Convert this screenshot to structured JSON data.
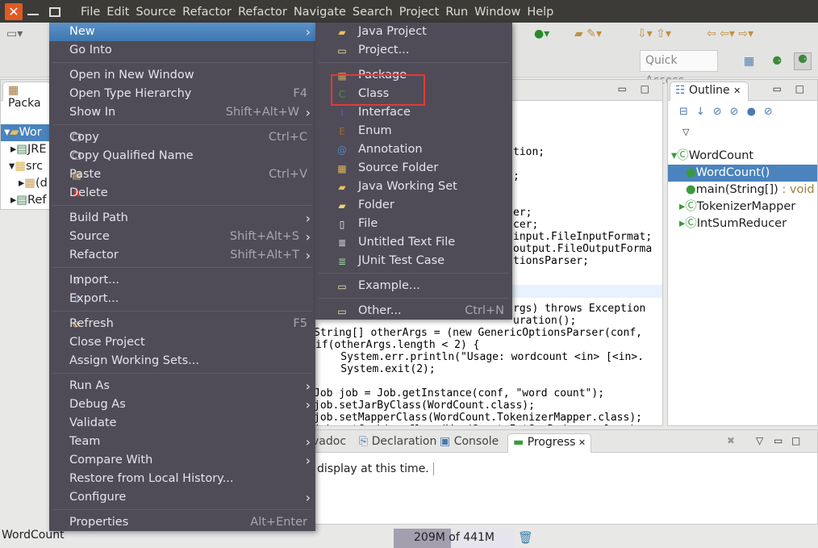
{
  "window": {
    "menus": [
      "File",
      "Edit",
      "Source",
      "Refactor",
      "Refactor",
      "Navigate",
      "Search",
      "Project",
      "Run",
      "Window",
      "Help"
    ]
  },
  "toolbar": {
    "quick_access": "Quick Access"
  },
  "package_explorer": {
    "tab": "Packa",
    "items": [
      "Wor",
      "JRE",
      "src",
      "(d",
      "Ref"
    ]
  },
  "editor": {
    "lines": [
      {
        "t": "tion;"
      },
      {
        "t": ";"
      },
      {
        "t": "er;"
      },
      {
        "t": "cer;"
      },
      {
        "t": "input.FileInputFormat;"
      },
      {
        "t": "output.FileOutputForma"
      },
      {
        "t": "tionsParser;"
      },
      {
        "t": "rgs) throws Exception"
      },
      {
        "t": "uration();"
      },
      {
        "t": "String[] otherArgs = (new GenericOptionsParser(conf,"
      },
      {
        "t": "if(otherArgs.length < 2) {"
      },
      {
        "t": "    System.err.println(\"Usage: wordcount <in> [<in>."
      },
      {
        "t": "    System.exit(2);"
      },
      {
        "t": "Job job = Job.getInstance(conf, \"word count\");"
      },
      {
        "t": "job.setJarByClass(WordCount.class);"
      },
      {
        "t": "job.setMapperClass(WordCount.TokenizerMapper.class);"
      },
      {
        "t": "job.setCombinerClass(WordCount.IntSumReducer.class);"
      }
    ]
  },
  "outline": {
    "tab": "Outline",
    "items": [
      {
        "label": "WordCount",
        "icon": "class-icon"
      },
      {
        "label": "WordCount()",
        "icon": "constructor-icon"
      },
      {
        "label": "main(String[])",
        "suffix": " : void",
        "icon": "method-icon"
      },
      {
        "label": "TokenizerMapper",
        "icon": "class-icon"
      },
      {
        "label": "IntSumReducer",
        "icon": "class-icon"
      }
    ]
  },
  "bottom": {
    "tabs": [
      "vadoc",
      "Declaration",
      "Console",
      "Progress"
    ],
    "message": "display at this time."
  },
  "status": {
    "selection": "WordCount",
    "memory": "209M of 441M",
    "heap_used_fraction": 0.47
  },
  "context_menu": [
    {
      "label": "New",
      "arrow": true,
      "highlight": true
    },
    {
      "label": "Go Into"
    },
    {
      "sep": true
    },
    {
      "label": "Open in New Window"
    },
    {
      "label": "Open Type Hierarchy",
      "shortcut": "F4"
    },
    {
      "label": "Show In",
      "shortcut": "Shift+Alt+W",
      "arrow": true
    },
    {
      "sep": true
    },
    {
      "label": "Copy",
      "shortcut": "Ctrl+C",
      "icon": "copy-icon",
      "glyph": "❐",
      "color": "#cfd6e6"
    },
    {
      "label": "Copy Qualified Name",
      "icon": "copy-icon",
      "glyph": "❐",
      "color": "#cfd6e6"
    },
    {
      "label": "Paste",
      "shortcut": "Ctrl+V",
      "icon": "paste-icon",
      "glyph": "▤",
      "color": "#e0c080"
    },
    {
      "label": "Delete",
      "icon": "delete-icon",
      "glyph": "✖",
      "color": "#e03030"
    },
    {
      "sep": true
    },
    {
      "label": "Build Path",
      "arrow": true
    },
    {
      "label": "Source",
      "shortcut": "Shift+Alt+S",
      "arrow": true
    },
    {
      "label": "Refactor",
      "shortcut": "Shift+Alt+T",
      "arrow": true
    },
    {
      "sep": true
    },
    {
      "label": "Import...",
      "icon": "import-icon",
      "glyph": "⇩",
      "color": "#a9c4e6"
    },
    {
      "label": "Export...",
      "icon": "export-icon",
      "glyph": "⇧",
      "color": "#a9c4e6"
    },
    {
      "sep": true
    },
    {
      "label": "Refresh",
      "shortcut": "F5",
      "icon": "refresh-icon",
      "glyph": "⟳",
      "color": "#e8b040"
    },
    {
      "label": "Close Project"
    },
    {
      "label": "Assign Working Sets..."
    },
    {
      "sep": true
    },
    {
      "label": "Run As",
      "arrow": true
    },
    {
      "label": "Debug As",
      "arrow": true
    },
    {
      "label": "Validate"
    },
    {
      "label": "Team",
      "arrow": true
    },
    {
      "label": "Compare With",
      "arrow": true
    },
    {
      "label": "Restore from Local History..."
    },
    {
      "label": "Configure",
      "arrow": true
    },
    {
      "sep": true
    },
    {
      "label": "Properties",
      "shortcut": "Alt+Enter"
    }
  ],
  "new_submenu": [
    {
      "label": "Java Project",
      "icon": "java-project-icon",
      "glyph": "▰",
      "color": "#e8c060"
    },
    {
      "label": "Project...",
      "icon": "project-icon",
      "glyph": "▭",
      "color": "#f0e0a0"
    },
    {
      "sep": true
    },
    {
      "label": "Package",
      "icon": "package-icon",
      "glyph": "▦",
      "color": "#c8a060"
    },
    {
      "label": "Class",
      "icon": "class-icon",
      "glyph": "C",
      "color": "#3a9a3a",
      "boxed": true
    },
    {
      "label": "Interface",
      "icon": "interface-icon",
      "glyph": "I",
      "color": "#7a50b0"
    },
    {
      "label": "Enum",
      "icon": "enum-icon",
      "glyph": "E",
      "color": "#a06a30"
    },
    {
      "label": "Annotation",
      "icon": "annotation-icon",
      "glyph": "@",
      "color": "#5080c0"
    },
    {
      "label": "Source Folder",
      "icon": "source-folder-icon",
      "glyph": "▦",
      "color": "#e0b050"
    },
    {
      "label": "Java Working Set",
      "icon": "working-set-icon",
      "glyph": "▰",
      "color": "#e8c060"
    },
    {
      "label": "Folder",
      "icon": "folder-icon",
      "glyph": "▰",
      "color": "#f0d070"
    },
    {
      "label": "File",
      "icon": "file-icon",
      "glyph": "▯",
      "color": "#f0f0f0"
    },
    {
      "label": "Untitled Text File",
      "icon": "text-file-icon",
      "glyph": "≣",
      "color": "#e0e6f0"
    },
    {
      "label": "JUnit Test Case",
      "icon": "junit-icon",
      "glyph": "≣",
      "color": "#a0d0a0"
    },
    {
      "sep": true
    },
    {
      "label": "Example...",
      "icon": "example-icon",
      "glyph": "▭",
      "color": "#f0e0a0"
    },
    {
      "sep": true
    },
    {
      "label": "Other...",
      "shortcut": "Ctrl+N",
      "icon": "other-icon",
      "glyph": "▭",
      "color": "#f0e0a0"
    }
  ],
  "colors": {
    "menu_bg": "#4f4c58",
    "highlight": "#4a83bd",
    "selection_box": "#e53935",
    "keyword": "#7f0055"
  }
}
